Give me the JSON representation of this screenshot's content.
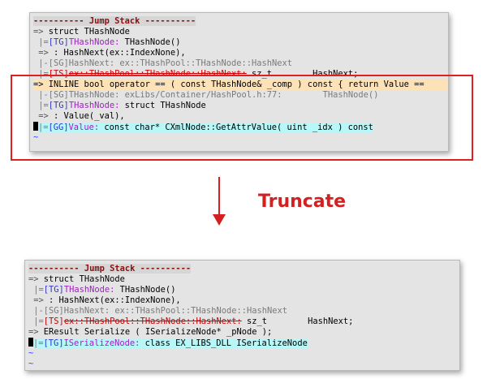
{
  "top_panel": {
    "lines": [
      {
        "kind": "header",
        "text": "---------- Jump Stack ----------"
      },
      {
        "kind": "plain",
        "arrow": "=> ",
        "text": "struct THashNode"
      },
      {
        "kind": "tagged",
        "bar": " |=",
        "tag": "[TG]",
        "type": "THashNode:",
        "rest": " THashNode()"
      },
      {
        "kind": "plain",
        "arrow": " => ",
        "text": ": HashNext(ex::IndexNone),"
      },
      {
        "kind": "grey",
        "text": " |-[SG]HashNext: ex::THashPool::THashNode::HashNext"
      },
      {
        "kind": "struck",
        "bar": " |=",
        "tag": "[TS]",
        "type": "ex::THashPool::THashNode::HashNext:",
        "rest": " sz_t        HashNext;"
      },
      {
        "kind": "orange",
        "text": "=> INLINE bool operator == ( const THashNode& _comp ) const { return Value =="
      },
      {
        "kind": "grey",
        "text": " |-[SG]THashNode: exLibs/Container/HashPool.h:77:        THashNode()"
      },
      {
        "kind": "tagged",
        "bar": " |=",
        "tag": "[TG]",
        "type": "THashNode:",
        "rest": " struct THashNode"
      },
      {
        "kind": "plain",
        "arrow": " => ",
        "text": ": Value(_val),"
      },
      {
        "kind": "cyan",
        "bar": "|=",
        "tag": "[GG]",
        "type": "Value:",
        "rest": " const char* CXmlNode::GetAttrValue( uint _idx ) const"
      },
      {
        "kind": "tilde",
        "text": "~"
      }
    ]
  },
  "annotation": {
    "label": "Truncate"
  },
  "bottom_panel": {
    "lines": [
      {
        "kind": "header",
        "text": "---------- Jump Stack ----------"
      },
      {
        "kind": "plain",
        "arrow": "=> ",
        "text": "struct THashNode"
      },
      {
        "kind": "tagged",
        "bar": " |=",
        "tag": "[TG]",
        "type": "THashNode:",
        "rest": " THashNode()"
      },
      {
        "kind": "plain",
        "arrow": " => ",
        "text": ": HashNext(ex::IndexNone),"
      },
      {
        "kind": "grey",
        "text": " |-[SG]HashNext: ex::THashPool::THashNode::HashNext"
      },
      {
        "kind": "struck",
        "bar": " |=",
        "tag": "[TS]",
        "type": "ex::THashPool::THashNode::HashNext:",
        "rest": " sz_t        HashNext;"
      },
      {
        "kind": "plain",
        "arrow": "=> ",
        "text": "EResult Serialize ( ISerializeNode* _pNode );"
      },
      {
        "kind": "cyan",
        "bar": "|=",
        "tag": "[TG]",
        "type": "ISerializeNode:",
        "rest": " class EX_LIBS_DLL ISerializeNode"
      },
      {
        "kind": "tilde",
        "text": "~"
      },
      {
        "kind": "tilde",
        "text": "~"
      }
    ]
  },
  "colors": {
    "header": "#8b1010",
    "highlight_rect": "#e02020",
    "orange_line": "#fde2b8",
    "cyan_line": "#b7f7f7",
    "label": "#d42020"
  }
}
